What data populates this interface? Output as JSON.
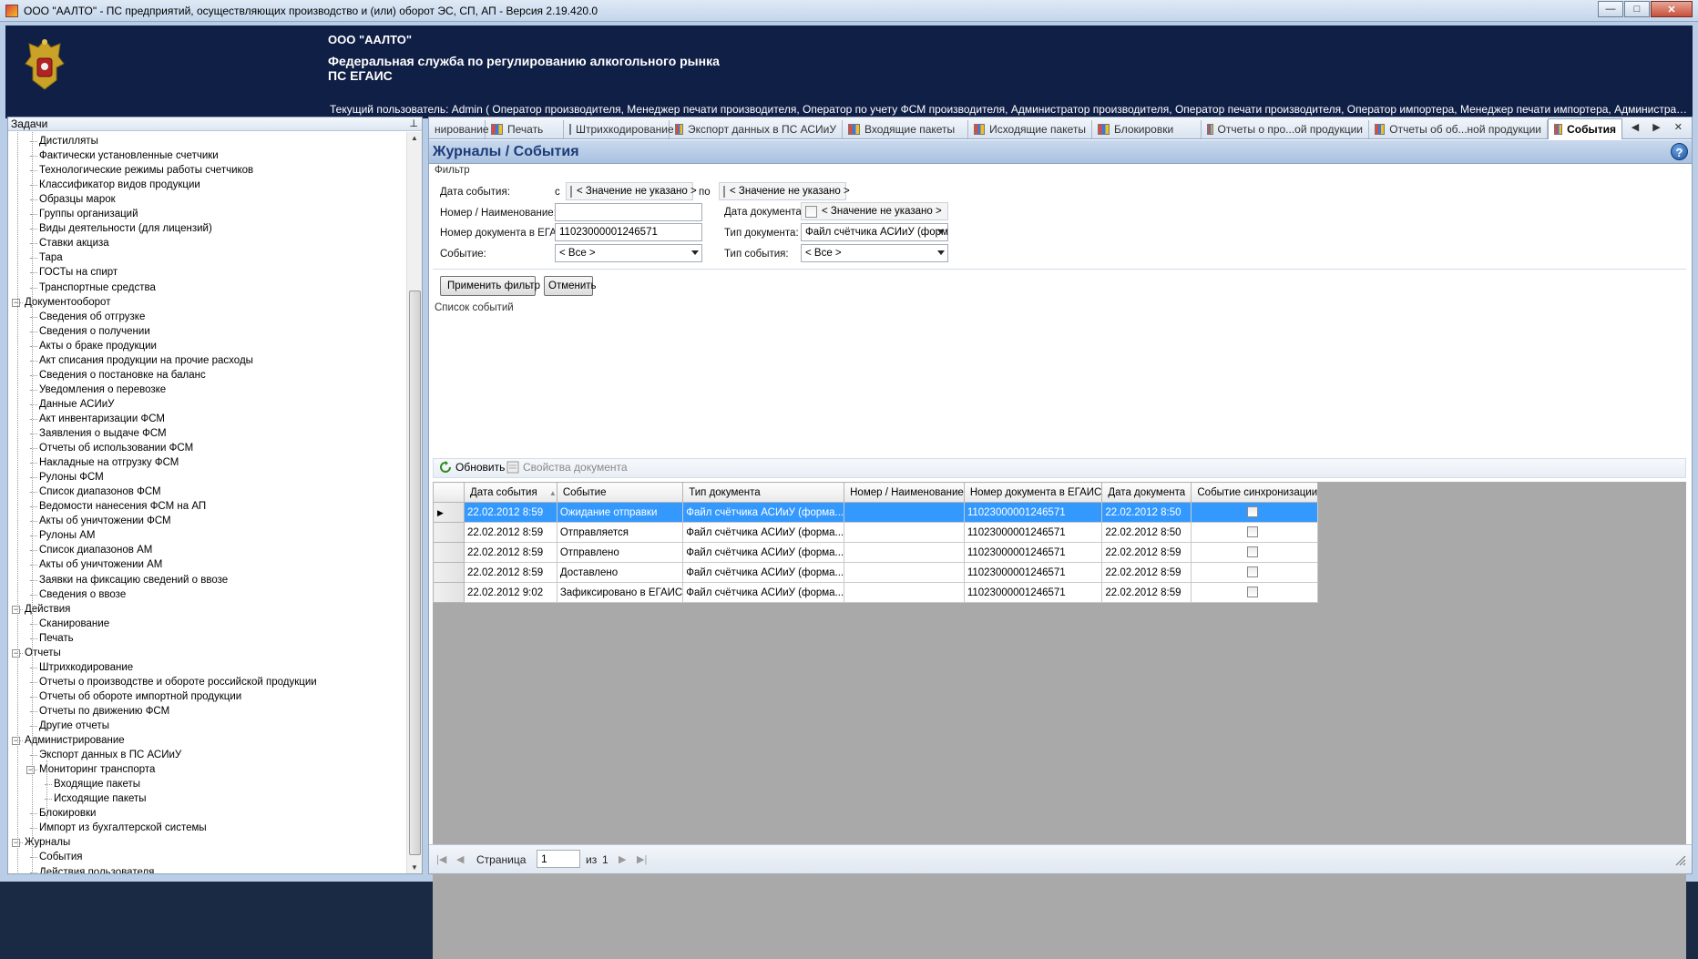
{
  "window": {
    "title": "ООО \"ААЛТО\" - ПС предприятий, осуществляющих производство и (или) оборот ЭС, СП, АП - Версия 2.19.420.0",
    "minimize": "—",
    "maximize": "□",
    "close": "✕"
  },
  "banner": {
    "org_name": "ООО \"ААЛТО\"",
    "agency_line1": "Федеральная служба по регулированию алкогольного рынка",
    "agency_line2": "ПС ЕГАИС",
    "current_user": "Текущий пользователь: Admin ( Оператор производителя, Менеджер печати производителя, Оператор по учету ФСМ производителя, Администратор производителя, Оператор печати производителя, Оператор импортера, Менеджер печати импортера, Администратор импортера, Операто..."
  },
  "left_panel": {
    "title": "Задачи",
    "pin": "⊥",
    "tree": [
      {
        "label": "Дистилляты",
        "level": 1
      },
      {
        "label": "Фактически установленные счетчики",
        "level": 1
      },
      {
        "label": "Технологические режимы работы счетчиков",
        "level": 1
      },
      {
        "label": "Классификатор видов продукции",
        "level": 1
      },
      {
        "label": "Образцы марок",
        "level": 1
      },
      {
        "label": "Группы организаций",
        "level": 1
      },
      {
        "label": "Виды деятельности (для лицензий)",
        "level": 1
      },
      {
        "label": "Ставки акциза",
        "level": 1
      },
      {
        "label": "Тара",
        "level": 1
      },
      {
        "label": "ГОСТы на спирт",
        "level": 1
      },
      {
        "label": "Транспортные средства",
        "level": 1
      },
      {
        "label": "Документооборот",
        "level": 0,
        "expanded": true
      },
      {
        "label": "Сведения об отгрузке",
        "level": 1
      },
      {
        "label": "Сведения о получении",
        "level": 1
      },
      {
        "label": "Акты о браке продукции",
        "level": 1
      },
      {
        "label": "Акт списания продукции на прочие расходы",
        "level": 1
      },
      {
        "label": "Сведения о постановке на баланс",
        "level": 1
      },
      {
        "label": "Уведомления о перевозке",
        "level": 1
      },
      {
        "label": "Данные АСИиУ",
        "level": 1
      },
      {
        "label": "Акт инвентаризации ФСМ",
        "level": 1
      },
      {
        "label": "Заявления о выдаче ФСМ",
        "level": 1
      },
      {
        "label": "Отчеты об использовании ФСМ",
        "level": 1
      },
      {
        "label": "Накладные на отгрузку ФСМ",
        "level": 1
      },
      {
        "label": "Рулоны ФСМ",
        "level": 1
      },
      {
        "label": "Список диапазонов ФСМ",
        "level": 1
      },
      {
        "label": "Ведомости нанесения ФСМ на АП",
        "level": 1
      },
      {
        "label": "Акты об уничтожении ФСМ",
        "level": 1
      },
      {
        "label": "Рулоны АМ",
        "level": 1
      },
      {
        "label": "Список диапазонов АМ",
        "level": 1
      },
      {
        "label": "Акты об уничтожении АМ",
        "level": 1
      },
      {
        "label": "Заявки на фиксацию сведений о ввозе",
        "level": 1
      },
      {
        "label": "Сведения о ввозе",
        "level": 1
      },
      {
        "label": "Действия",
        "level": 0,
        "expanded": true
      },
      {
        "label": "Сканирование",
        "level": 1
      },
      {
        "label": "Печать",
        "level": 1
      },
      {
        "label": "Отчеты",
        "level": 0,
        "expanded": true
      },
      {
        "label": "Штрихкодирование",
        "level": 1
      },
      {
        "label": "Отчеты о производстве и обороте российской продукции",
        "level": 1
      },
      {
        "label": "Отчеты об обороте импортной продукции",
        "level": 1
      },
      {
        "label": "Отчеты по движению ФСМ",
        "level": 1
      },
      {
        "label": "Другие отчеты",
        "level": 1
      },
      {
        "label": "Администрирование",
        "level": 0,
        "expanded": true
      },
      {
        "label": "Экспорт данных в ПС АСИиУ",
        "level": 1
      },
      {
        "label": "Мониторинг транспорта",
        "level": 1,
        "expanded": true
      },
      {
        "label": "Входящие пакеты",
        "level": 2
      },
      {
        "label": "Исходящие пакеты",
        "level": 2
      },
      {
        "label": "Блокировки",
        "level": 1
      },
      {
        "label": "Импорт из бухгалтерской системы",
        "level": 1
      },
      {
        "label": "Журналы",
        "level": 0,
        "expanded": true
      },
      {
        "label": "События",
        "level": 1
      },
      {
        "label": "Действия пользователя",
        "level": 1
      }
    ]
  },
  "tabs": [
    {
      "label": "нирование",
      "icon": false
    },
    {
      "label": "Печать",
      "icon": true
    },
    {
      "label": "Штрихкодирование",
      "icon": true
    },
    {
      "label": "Экспорт данных в ПС АСИиУ",
      "icon": true
    },
    {
      "label": "Входящие пакеты",
      "icon": true
    },
    {
      "label": "Исходящие пакеты",
      "icon": true
    },
    {
      "label": "Блокировки",
      "icon": true
    },
    {
      "label": "Отчеты о про...ой продукции",
      "icon": true
    },
    {
      "label": "Отчеты об об...ной продукции",
      "icon": true
    },
    {
      "label": "События",
      "icon": true,
      "active": true
    }
  ],
  "tab_nav": "◀ ▶ ✕",
  "page": {
    "title": "Журналы / События",
    "help": "?"
  },
  "filter": {
    "group_title": "Фильтр",
    "event_date_label": "Дата события:",
    "from_label": "с",
    "to_label": "по",
    "from_value": "< Значение не указано >",
    "to_value": "< Значение не указано >",
    "number_label": "Номер / Наименование:",
    "number_value": "",
    "doc_date_label": "Дата документа:",
    "doc_date_value": "< Значение не указано >",
    "egais_number_label": "Номер документа в ЕГАИС:",
    "egais_number_value": "11023000001246571",
    "doc_type_label": "Тип документа:",
    "doc_type_value": "Файл счётчика АСИиУ (форма...",
    "event_label": "Событие:",
    "event_value": "< Все >",
    "event_type_label": "Тип события:",
    "event_type_value": "< Все >",
    "apply_button": "Применить фильтр",
    "cancel_button": "Отменить"
  },
  "events": {
    "group_title": "Список событий",
    "refresh_button": "Обновить",
    "properties_button": "Свойства документа",
    "columns": [
      "Дата события",
      "Событие",
      "Тип документа",
      "Номер / Наименование",
      "Номер документа в ЕГАИС",
      "Дата документа",
      "Событие синхронизации"
    ],
    "sort_indicator": "▲",
    "row_indicator": "▶",
    "rows": [
      {
        "date": "22.02.2012 8:59",
        "event": "Ожидание отправки",
        "doc_type": "Файл счётчика АСИиУ (форма...",
        "number": "",
        "egais": "11023000001246571",
        "doc_date": "22.02.2012 8:50",
        "sync": false,
        "selected": true
      },
      {
        "date": "22.02.2012 8:59",
        "event": "Отправляется",
        "doc_type": "Файл счётчика АСИиУ (форма...",
        "number": "",
        "egais": "11023000001246571",
        "doc_date": "22.02.2012 8:50",
        "sync": false
      },
      {
        "date": "22.02.2012 8:59",
        "event": "Отправлено",
        "doc_type": "Файл счётчика АСИиУ (форма...",
        "number": "",
        "egais": "11023000001246571",
        "doc_date": "22.02.2012 8:59",
        "sync": false
      },
      {
        "date": "22.02.2012 8:59",
        "event": "Доставлено",
        "doc_type": "Файл счётчика АСИиУ (форма...",
        "number": "",
        "egais": "11023000001246571",
        "doc_date": "22.02.2012 8:59",
        "sync": false
      },
      {
        "date": "22.02.2012 9:02",
        "event": "Зафиксировано в ЕГАИС",
        "doc_type": "Файл счётчика АСИиУ (форма...",
        "number": "",
        "egais": "11023000001246571",
        "doc_date": "22.02.2012 8:59",
        "sync": false
      }
    ]
  },
  "pager": {
    "page_label": "Страница",
    "page_value": "1",
    "of_label": "из",
    "total": "1",
    "first": "|◀",
    "prev": "◀",
    "next": "▶",
    "last": "▶|"
  },
  "colors": {
    "banner_bg": "#0f1f45",
    "selection": "#3399ff",
    "title_blue": "#1d3b79"
  }
}
